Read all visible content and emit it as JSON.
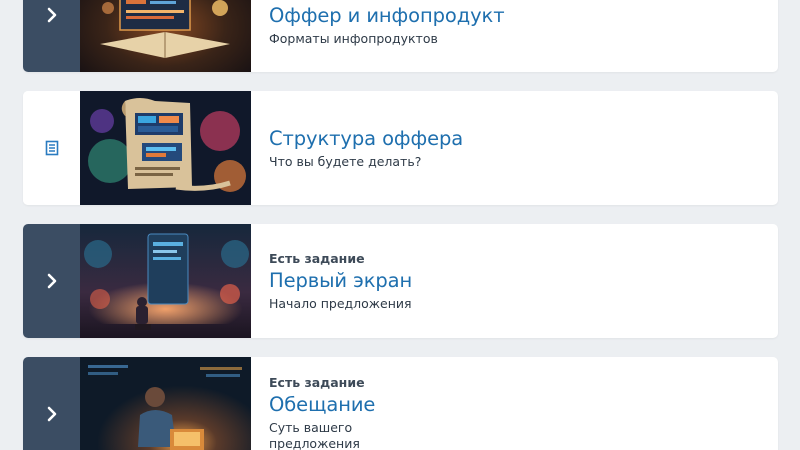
{
  "lessons": [
    {
      "task_label": "",
      "title": "Оффер и инфопродукт",
      "subtitle": "Форматы инфопродуктов",
      "state": "collapsed"
    },
    {
      "task_label": "",
      "title": "Структура оффера",
      "subtitle": "Что вы будете делать?",
      "state": "current"
    },
    {
      "task_label": "Есть задание",
      "title": "Первый экран",
      "subtitle": "Начало предложения",
      "state": "collapsed"
    },
    {
      "task_label": "Есть задание",
      "title": "Обещание",
      "subtitle": "Суть вашего предложения",
      "state": "collapsed"
    }
  ],
  "icons": {
    "expand": "chevron-right-icon",
    "current": "document-list-icon"
  },
  "colors": {
    "background": "#eceff2",
    "card": "#ffffff",
    "side_panel": "#3b4d63",
    "title": "#1e6fae",
    "accent_icon": "#2a7bc0"
  }
}
